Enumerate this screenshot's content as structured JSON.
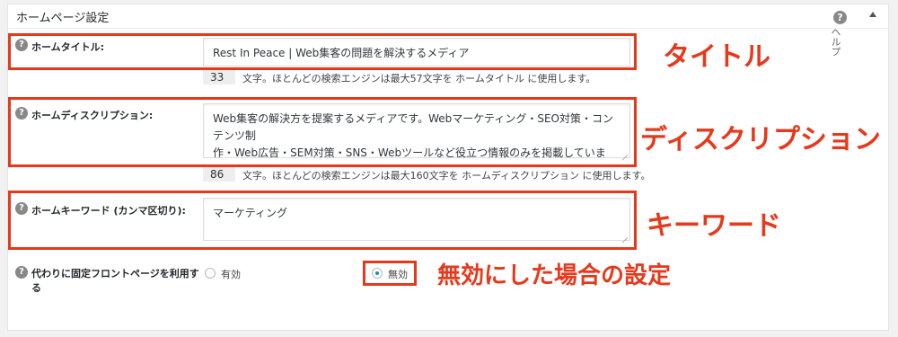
{
  "panel": {
    "title": "ホームページ設定",
    "help_text": "ヘルプ"
  },
  "home_title": {
    "label": "ホームタイトル:",
    "value": "Rest In Peace | Web集客の問題を解決するメディア",
    "count": "33",
    "count_text": "文字。ほとんどの検索エンジンは最大57文字を ホームタイトル に使用します。",
    "annotation": "タイトル"
  },
  "home_description": {
    "label": "ホームディスクリプション:",
    "value_line1": "Web集客の解決方を提案するメディアです。Webマーケティング・SEO対策・コンテンツ制",
    "value_line2": "作・Web広告・SEM対策・SNS・Webツールなど役立つ情報のみを掲載しています。",
    "count": "86",
    "count_text": "文字。ほとんどの検索エンジンは最大160文字を ホームディスクリプション に使用します。",
    "annotation": "ディスクリプション"
  },
  "home_keywords": {
    "label": "ホームキーワード (カンマ区切り):",
    "value": "マーケティング",
    "annotation": "キーワード"
  },
  "static_front": {
    "label_line1": "代わりに固定フロントページを利用す",
    "label_line2": "る",
    "options": [
      {
        "label": "有効",
        "selected": false
      },
      {
        "label": "無効",
        "selected": true
      }
    ],
    "annotation": "無効にした場合の設定"
  },
  "colors": {
    "highlight": "#e8381b",
    "radio_selected": "#1e8cbe"
  },
  "icons": {
    "help": "question-circle-icon",
    "toggle": "triangle-up-icon"
  }
}
